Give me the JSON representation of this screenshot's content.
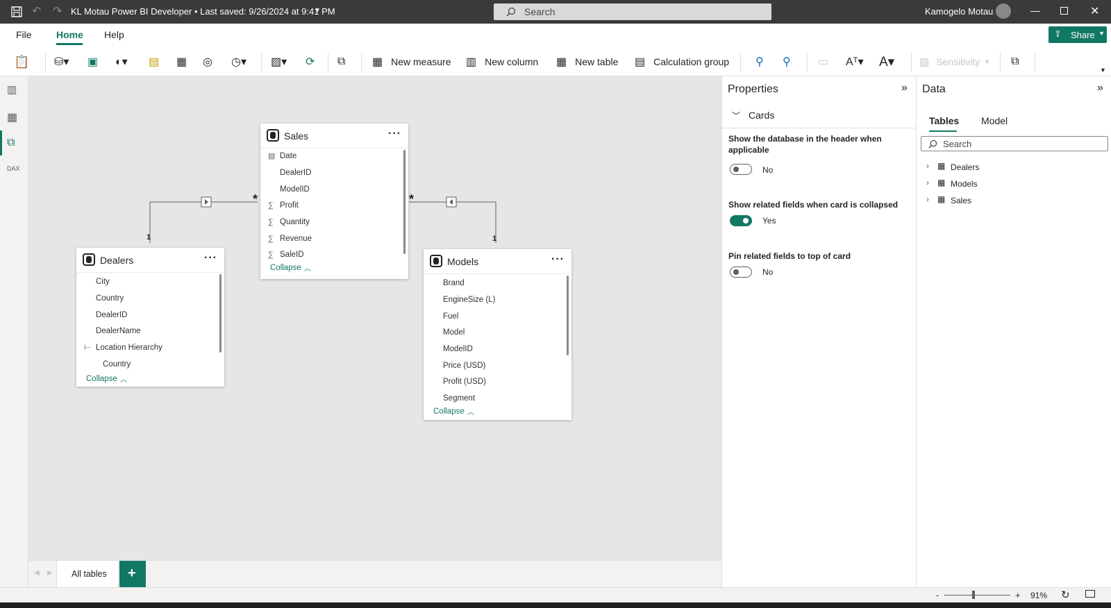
{
  "titlebar": {
    "title": "KL Motau Power BI Developer • Last saved: 9/26/2024 at 9:41 PM",
    "search_placeholder": "Search",
    "user": "Kamogelo Motau"
  },
  "menu": {
    "file": "File",
    "home": "Home",
    "help": "Help",
    "share": "Share"
  },
  "ribbon": {
    "new_measure": "New measure",
    "new_column": "New column",
    "new_table": "New table",
    "calculation_group": "Calculation group",
    "sensitivity": "Sensitivity"
  },
  "tables": {
    "sales": {
      "name": "Sales",
      "fields": [
        "Date",
        "DealerID",
        "ModelID",
        "Profit",
        "Quantity",
        "Revenue",
        "SaleID"
      ],
      "collapse": "Collapse"
    },
    "dealers": {
      "name": "Dealers",
      "fields": [
        "City",
        "Country",
        "DealerID",
        "DealerName",
        "Location Hierarchy",
        "Country"
      ],
      "collapse": "Collapse"
    },
    "models": {
      "name": "Models",
      "fields": [
        "Brand",
        "EngineSize (L)",
        "Fuel",
        "Model",
        "ModelID",
        "Price (USD)",
        "Profit (USD)",
        "Segment"
      ],
      "collapse": "Collapse"
    }
  },
  "relationships": {
    "one": "1",
    "many": "*"
  },
  "bottom_tabs": {
    "all_tables": "All tables",
    "add": "+"
  },
  "properties": {
    "title": "Properties",
    "section": "Cards",
    "opt1": {
      "label": "Show the database in the header when applicable",
      "value": "No",
      "on": false
    },
    "opt2": {
      "label": "Show related fields when card is collapsed",
      "value": "Yes",
      "on": true
    },
    "opt3": {
      "label": "Pin related fields to top of card",
      "value": "No",
      "on": false
    }
  },
  "data_pane": {
    "title": "Data",
    "tab_tables": "Tables",
    "tab_model": "Model",
    "search_placeholder": "Search",
    "tables": [
      "Dealers",
      "Models",
      "Sales"
    ]
  },
  "status": {
    "zoom": "91%",
    "minus": "-",
    "plus": "+"
  },
  "colors": {
    "accent": "#117865",
    "titlebar": "#3b3a39",
    "canvas": "#e6e6e6"
  }
}
